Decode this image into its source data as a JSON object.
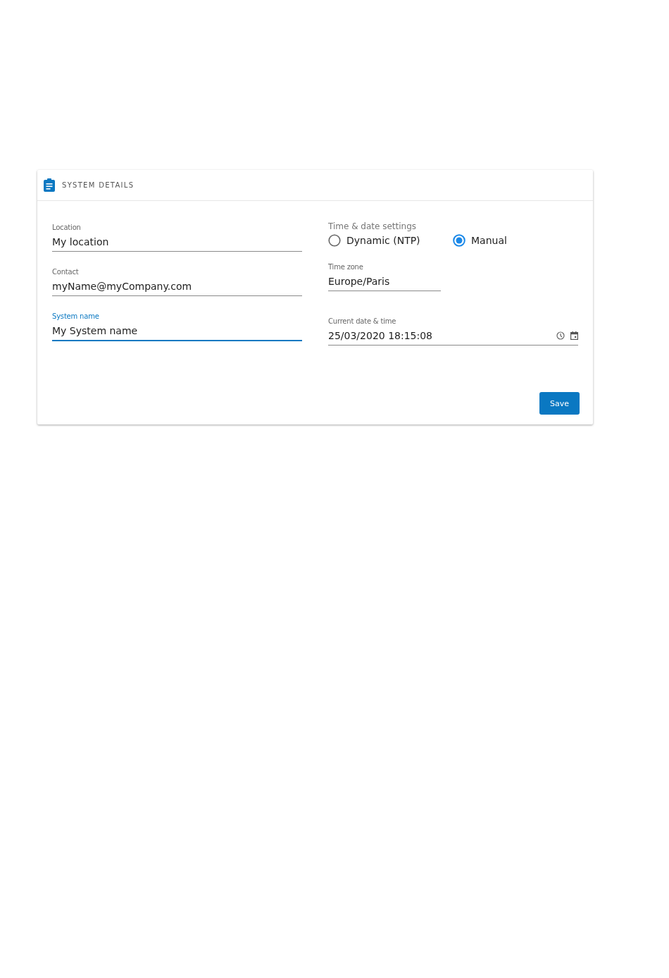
{
  "card": {
    "title": "SYSTEM DETAILS"
  },
  "fields": [
    {
      "label": "Location",
      "value": "My location",
      "focused": false
    },
    {
      "label": "Contact",
      "value": "myName@myCompany.com",
      "focused": false
    },
    {
      "label": "System name",
      "value": "My System name",
      "focused": true
    }
  ],
  "time_settings": {
    "title": "Time & date settings",
    "options": [
      {
        "label": "Dynamic (NTP)",
        "selected": false
      },
      {
        "label": "Manual",
        "selected": true
      }
    ],
    "time_zone": {
      "label": "Time zone",
      "value": "Europe/Paris"
    },
    "current_datetime": {
      "label": "Current date & time",
      "value": "25/03/2020 18:15:08"
    }
  },
  "buttons": [
    {
      "label": "Save"
    }
  ]
}
